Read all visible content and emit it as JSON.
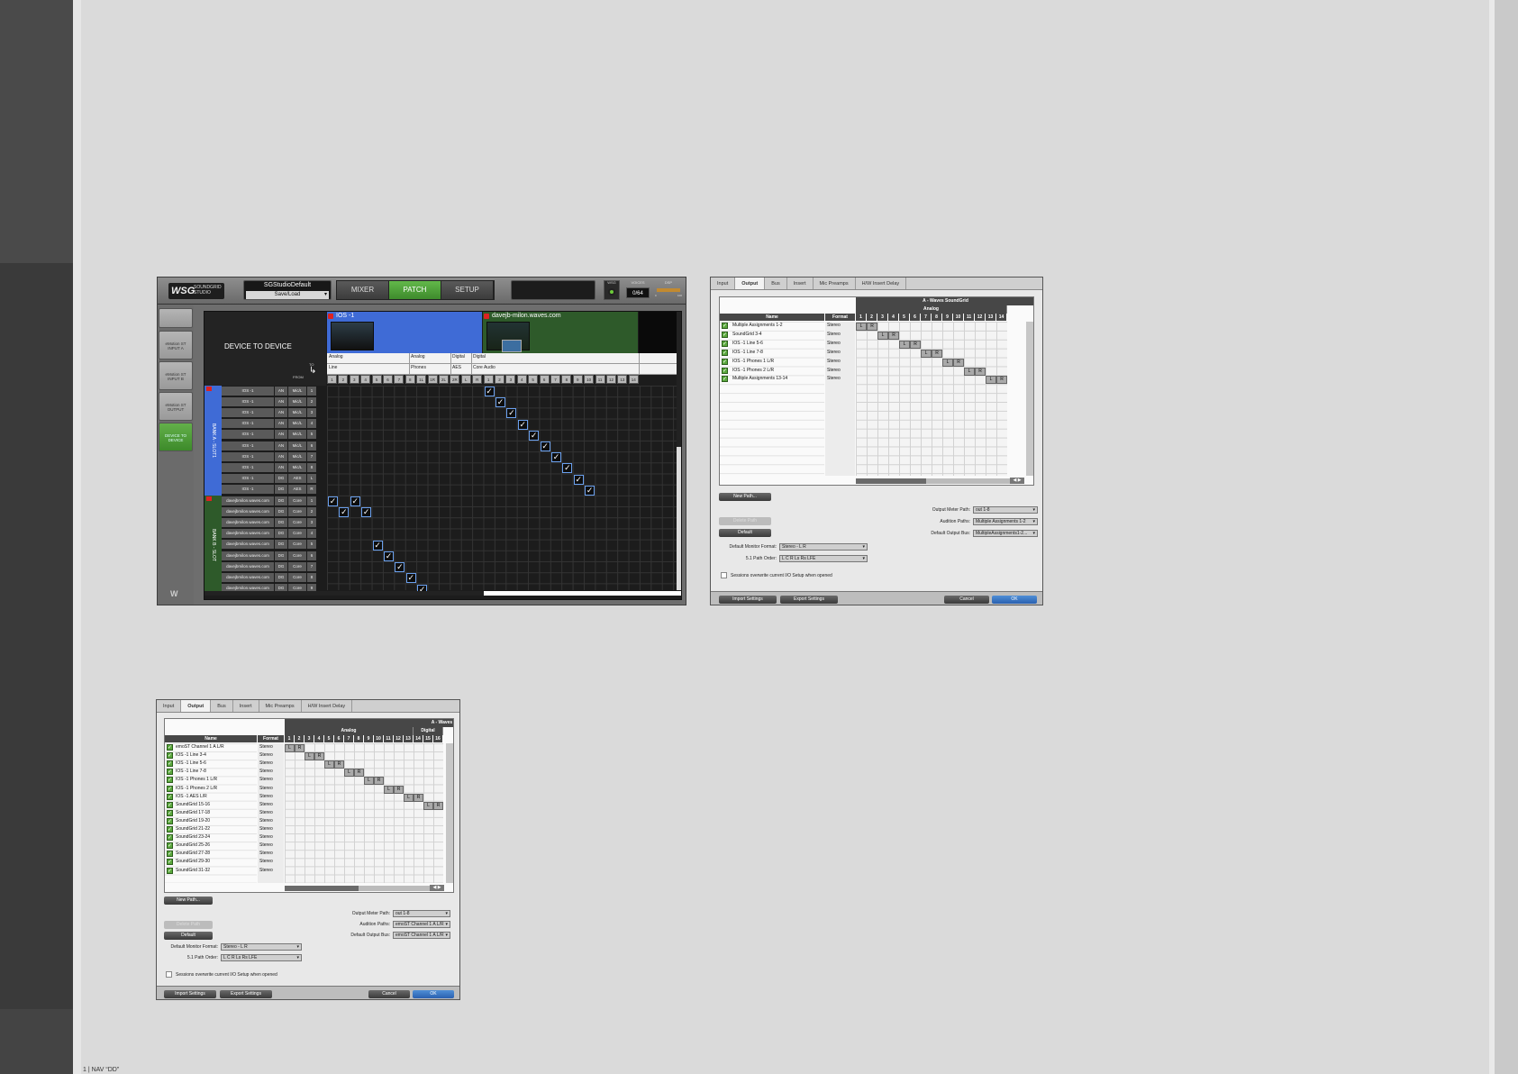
{
  "footer": "1 | NAV “DD”",
  "soundgrid": {
    "logo_mark": "WSG",
    "logo_text": "SOUNDGRID STUDIO",
    "preset_name": "SGStudioDefault",
    "save_load": "Save/Load",
    "tabs": [
      "MIXER",
      "PATCH",
      "SETUP"
    ],
    "active_tab": "PATCH",
    "wsg_label": "WSG",
    "voices_label": "VOICES",
    "voices_value": "0/64",
    "dsp_label": "DSP",
    "dsp_scale": [
      "0",
      "100"
    ],
    "sidebar": [
      "eMotion ST INPUT A",
      "eMotion ST INPUT B",
      "eMotion ST OUTPUT",
      "DEVICE TO DEVICE"
    ],
    "active_sidebar": "DEVICE TO DEVICE",
    "title": "DEVICE TO DEVICE",
    "to_label": "TO",
    "from_label": "FROM",
    "devices": [
      {
        "name": "IOS -1",
        "color": "#3f6bd6"
      },
      {
        "name": "davejb-milon.waves.com",
        "color": "#2e5a2a"
      }
    ],
    "header_row1": [
      "Analog",
      "Analog",
      "Digital",
      "Digital"
    ],
    "header_row2": [
      "Line",
      "Phones",
      "AES",
      "Core Audio"
    ],
    "columns": [
      "1",
      "2",
      "3",
      "4",
      "5",
      "6",
      "7",
      "8",
      "1L",
      "1R",
      "2L",
      "2R",
      "L",
      "R",
      "1",
      "2",
      "3",
      "4",
      "5",
      "6",
      "7",
      "8",
      "9",
      "10",
      "11",
      "12",
      "13",
      "14"
    ],
    "banks": [
      {
        "label": "BANK A - SLOT1",
        "color": "#3f6bd6"
      },
      {
        "label": "BANK B - SLOT",
        "color": "#2e5a2a"
      }
    ],
    "rows": [
      {
        "name": "IOS -1",
        "type": "AN",
        "fmt": "Mic/L",
        "ch": "1"
      },
      {
        "name": "IOS -1",
        "type": "AN",
        "fmt": "Mic/L",
        "ch": "2"
      },
      {
        "name": "IOS -1",
        "type": "AN",
        "fmt": "Mic/L",
        "ch": "3"
      },
      {
        "name": "IOS -1",
        "type": "AN",
        "fmt": "Mic/L",
        "ch": "4"
      },
      {
        "name": "IOS -1",
        "type": "AN",
        "fmt": "Mic/L",
        "ch": "5"
      },
      {
        "name": "IOS -1",
        "type": "AN",
        "fmt": "Mic/L",
        "ch": "6"
      },
      {
        "name": "IOS -1",
        "type": "AN",
        "fmt": "Mic/L",
        "ch": "7"
      },
      {
        "name": "IOS -1",
        "type": "AN",
        "fmt": "Mic/L",
        "ch": "8"
      },
      {
        "name": "IOS -1",
        "type": "DG",
        "fmt": "AES",
        "ch": "L"
      },
      {
        "name": "IOS -1",
        "type": "DG",
        "fmt": "AES",
        "ch": "R"
      },
      {
        "name": "davejbmilon.waves.com",
        "type": "DG",
        "fmt": "Core",
        "ch": "1"
      },
      {
        "name": "davejbmilon.waves.com",
        "type": "DG",
        "fmt": "Core",
        "ch": "2"
      },
      {
        "name": "davejbmilon.waves.com",
        "type": "DG",
        "fmt": "Core",
        "ch": "3"
      },
      {
        "name": "davejbmilon.waves.com",
        "type": "DG",
        "fmt": "Core",
        "ch": "4"
      },
      {
        "name": "davejbmilon.waves.com",
        "type": "DG",
        "fmt": "Core",
        "ch": "5"
      },
      {
        "name": "davejbmilon.waves.com",
        "type": "DG",
        "fmt": "Core",
        "ch": "6"
      },
      {
        "name": "davejbmilon.waves.com",
        "type": "DG",
        "fmt": "Core",
        "ch": "7"
      },
      {
        "name": "davejbmilon.waves.com",
        "type": "DG",
        "fmt": "Core",
        "ch": "8"
      },
      {
        "name": "davejbmilon.waves.com",
        "type": "DG",
        "fmt": "Core",
        "ch": "9"
      }
    ],
    "checks": [
      [
        0,
        14
      ],
      [
        1,
        15
      ],
      [
        2,
        16
      ],
      [
        3,
        17
      ],
      [
        4,
        18
      ],
      [
        5,
        19
      ],
      [
        6,
        20
      ],
      [
        7,
        21
      ],
      [
        8,
        22
      ],
      [
        9,
        23
      ],
      [
        10,
        0
      ],
      [
        10,
        2
      ],
      [
        11,
        1
      ],
      [
        11,
        3
      ],
      [
        14,
        4
      ],
      [
        15,
        5
      ],
      [
        16,
        6
      ],
      [
        17,
        7
      ],
      [
        18,
        8
      ]
    ]
  },
  "io_output_1": {
    "tabs": [
      "Input",
      "Output",
      "Bus",
      "Insert",
      "Mic Preamps",
      "H/W Insert Delay"
    ],
    "active_tab": "Output",
    "device_header": "A - Waves SoundGrid",
    "group_headers": [
      "Analog"
    ],
    "col_name": "Name",
    "col_format": "Format",
    "columns": [
      "1",
      "2",
      "3",
      "4",
      "5",
      "6",
      "7",
      "8",
      "9",
      "10",
      "11",
      "12",
      "13",
      "14"
    ],
    "rows": [
      {
        "name": "Multiple Assignments 1-2",
        "format": "Stereo",
        "l": 0
      },
      {
        "name": "SoundGrid 3-4",
        "format": "Stereo",
        "l": 2
      },
      {
        "name": "IOS -1 Line 5-6",
        "format": "Stereo",
        "l": 4
      },
      {
        "name": "IOS -1 Line 7-8",
        "format": "Stereo",
        "l": 6
      },
      {
        "name": "IOS -1 Phones 1 L/R",
        "format": "Stereo",
        "l": 8
      },
      {
        "name": "IOS -1 Phones 2 L/R",
        "format": "Stereo",
        "l": 10
      },
      {
        "name": "Multiple Assignments 13-14",
        "format": "Stereo",
        "l": 12
      }
    ],
    "new_path": "New Path...",
    "delete_path": "Delete Path",
    "default": "Default",
    "output_meter_label": "Output Meter Path:",
    "output_meter_value": "out 1-8",
    "audition_label": "Audition Paths:",
    "audition_value": "Multiple Assignments 1-2",
    "default_bus_label": "Default Output Bus:",
    "default_bus_value": "MultipleAssignments1-2...",
    "monitor_format_label": "Default Monitor Format:",
    "monitor_format_value": "Stereo - L R",
    "path_order_label": "5.1 Path Order:",
    "path_order_value": "L C R Ls Rs LFE",
    "overwrite_label": "Sessions overwrite current I/O Setup when opened",
    "import": "Import Settings",
    "export": "Export Settings",
    "cancel": "Cancel",
    "ok": "OK"
  },
  "io_output_2": {
    "tabs": [
      "Input",
      "Output",
      "Bus",
      "Insert",
      "Mic Preamps",
      "H/W Insert Delay"
    ],
    "active_tab": "Output",
    "device_header": "A - Waves I",
    "group_headers": [
      "Analog",
      "Digital"
    ],
    "col_name": "Name",
    "col_format": "Format",
    "columns": [
      "1",
      "2",
      "3",
      "4",
      "5",
      "6",
      "7",
      "8",
      "9",
      "10",
      "11",
      "12",
      "13",
      "14",
      "15",
      "16"
    ],
    "rows": [
      {
        "name": "emoST Channel 1 A L/R",
        "format": "Stereo",
        "l": 0
      },
      {
        "name": "IOS -1 Line 3-4",
        "format": "Stereo",
        "l": 2
      },
      {
        "name": "IOS -1 Line 5-6",
        "format": "Stereo",
        "l": 4
      },
      {
        "name": "IOS -1 Line 7-8",
        "format": "Stereo",
        "l": 6
      },
      {
        "name": "IOS -1 Phones 1 L/R",
        "format": "Stereo",
        "l": 8
      },
      {
        "name": "IOS -1 Phones 2 L/R",
        "format": "Stereo",
        "l": 10
      },
      {
        "name": "IOS -1 AES  L/R",
        "format": "Stereo",
        "l": 12
      },
      {
        "name": "SoundGrid 15-16",
        "format": "Stereo",
        "l": 14
      },
      {
        "name": "SoundGrid 17-18",
        "format": "Stereo",
        "l": -1
      },
      {
        "name": "SoundGrid 19-20",
        "format": "Stereo",
        "l": -1
      },
      {
        "name": "SoundGrid 21-22",
        "format": "Stereo",
        "l": -1
      },
      {
        "name": "SoundGrid 23-24",
        "format": "Stereo",
        "l": -1
      },
      {
        "name": "SoundGrid 25-26",
        "format": "Stereo",
        "l": -1
      },
      {
        "name": "SoundGrid 27-28",
        "format": "Stereo",
        "l": -1
      },
      {
        "name": "SoundGrid 29-30",
        "format": "Stereo",
        "l": -1
      },
      {
        "name": "SoundGrid 31-32",
        "format": "Stereo",
        "l": -1
      }
    ],
    "new_path": "New Path...",
    "delete_path": "Delete Path",
    "default": "Default",
    "output_meter_label": "Output Meter Path:",
    "output_meter_value": "out 1-8",
    "audition_label": "Audition Paths:",
    "audition_value": "emoST Channel 1 A L/R",
    "default_bus_label": "Default Output Bus:",
    "default_bus_value": "emoST Channel 1 A L/R",
    "monitor_format_label": "Default Monitor Format:",
    "monitor_format_value": "Stereo - L R",
    "path_order_label": "5.1 Path Order:",
    "path_order_value": "L C R Ls Rs LFE",
    "overwrite_label": "Sessions overwrite current I/O Setup when opened",
    "import": "Import Settings",
    "export": "Export Settings",
    "cancel": "Cancel",
    "ok": "OK"
  }
}
